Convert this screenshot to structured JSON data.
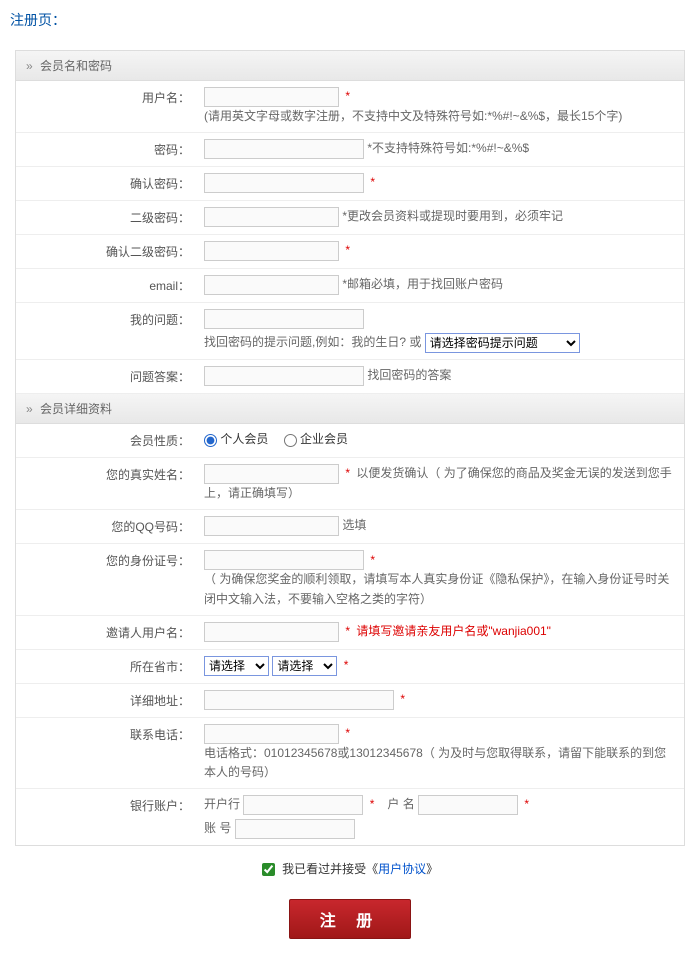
{
  "page_title": "注册页：",
  "sections": {
    "account": {
      "header": "会员名和密码"
    },
    "detail": {
      "header": "会员详细资料"
    }
  },
  "labels": {
    "username": "用户名：",
    "password": "密码：",
    "confirm_password": "确认密码：",
    "second_password": "二级密码：",
    "confirm_second_password": "确认二级密码：",
    "email": "email：",
    "my_question": "我的问题：",
    "question_answer": "问题答案：",
    "member_type": "会员性质：",
    "real_name": "您的真实姓名：",
    "qq": "您的QQ号码：",
    "id_card": "您的身份证号：",
    "inviter": "邀请人用户名：",
    "province": "所在省市：",
    "address": "详细地址：",
    "phone": "联系电话：",
    "bank": "银行账户："
  },
  "hints": {
    "username": "(请用英文字母或数字注册，不支持中文及特殊符号如:*%#!~&%$，最长15个字)",
    "password": "*不支持特殊符号如:*%#!~&%$",
    "second_password": "*更改会员资料或提现时要用到，必须牢记",
    "email": "*邮箱必填，用于找回账户密码",
    "my_question": "找回密码的提示问题,例如：我的生日? 或",
    "question_answer": "找回密码的答案",
    "real_name": "以便发货确认（ 为了确保您的商品及奖金无误的发送到您手上，请正确填写）",
    "qq": "选填",
    "id_card": "（ 为确保您奖金的顺利领取，请填写本人真实身份证《隐私保护》，在输入身份证号时关闭中文输入法，不要输入空格之类的字符）",
    "inviter": "请填写邀请亲友用户名或",
    "inviter_example": "\"wanjia001\"",
    "phone": "电话格式：01012345678或13012345678（ 为及时与您取得联系，请留下能联系的到您本人的号码）"
  },
  "radios": {
    "personal": "个人会员",
    "enterprise": "企业会员"
  },
  "selects": {
    "question_placeholder": "请选择密码提示问题",
    "province_placeholder": "请选择",
    "city_placeholder": "请选择"
  },
  "bank_fields": {
    "bank_name": "开户行",
    "account_name": "户    名",
    "account_no": "账    号"
  },
  "agreement": {
    "prefix": "我已看过并接受《",
    "link": "用户协议",
    "suffix": "》"
  },
  "submit": "注    册",
  "asterisk": "*"
}
